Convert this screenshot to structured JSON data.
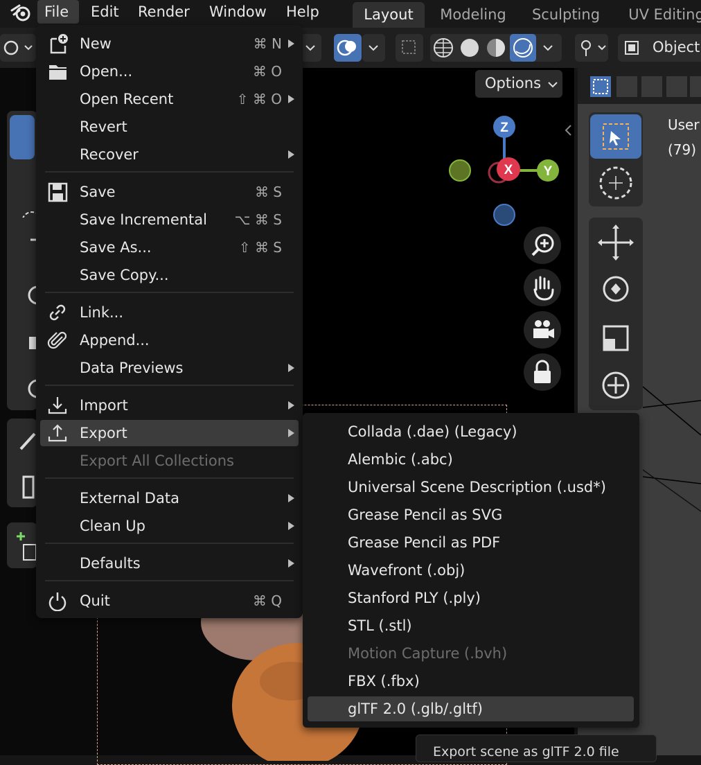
{
  "top_menu": {
    "file": "File",
    "edit": "Edit",
    "render": "Render",
    "window": "Window",
    "help": "Help"
  },
  "workspaces": [
    "Layout",
    "Modeling",
    "Sculpting",
    "UV Editing"
  ],
  "header": {
    "options_label": "Options",
    "object_mode_label": "Object"
  },
  "viewport_right": {
    "view_name": "User",
    "frame": "(79)"
  },
  "gizmo": {
    "x": "X",
    "y": "Y",
    "z": "Z"
  },
  "file_menu": {
    "items": [
      {
        "label": "New",
        "shortcut": "⌘ N",
        "icon": "new-file-icon",
        "submenu": true
      },
      {
        "label": "Open...",
        "shortcut": "⌘ O",
        "icon": "folder-icon"
      },
      {
        "label": "Open Recent",
        "shortcut": "⇧ ⌘ O",
        "submenu": true
      },
      {
        "label": "Revert"
      },
      {
        "label": "Recover",
        "submenu": true
      },
      {
        "label": "Save",
        "shortcut": "⌘ S",
        "icon": "save-icon"
      },
      {
        "label": "Save Incremental",
        "shortcut": "⌥ ⌘ S"
      },
      {
        "label": "Save As...",
        "shortcut": "⇧ ⌘ S"
      },
      {
        "label": "Save Copy..."
      },
      {
        "label": "Link...",
        "icon": "link-icon"
      },
      {
        "label": "Append...",
        "icon": "paperclip-icon"
      },
      {
        "label": "Data Previews",
        "submenu": true
      },
      {
        "label": "Import",
        "icon": "import-icon",
        "submenu": true
      },
      {
        "label": "Export",
        "icon": "export-icon",
        "submenu": true,
        "highlighted": true
      },
      {
        "label": "Export All Collections",
        "disabled": true
      },
      {
        "label": "External Data",
        "submenu": true
      },
      {
        "label": "Clean Up",
        "submenu": true
      },
      {
        "label": "Defaults",
        "submenu": true
      },
      {
        "label": "Quit",
        "shortcut": "⌘ Q",
        "icon": "power-icon"
      }
    ]
  },
  "export_menu": {
    "items": [
      {
        "label": "Collada (.dae) (Legacy)"
      },
      {
        "label": "Alembic (.abc)"
      },
      {
        "label": "Universal Scene Description (.usd*)"
      },
      {
        "label": "Grease Pencil as SVG"
      },
      {
        "label": "Grease Pencil as PDF"
      },
      {
        "label": "Wavefront (.obj)"
      },
      {
        "label": "Stanford PLY (.ply)"
      },
      {
        "label": "STL (.stl)"
      },
      {
        "label": "Motion Capture (.bvh)",
        "disabled": true
      },
      {
        "label": "FBX (.fbx)"
      },
      {
        "label": "glTF 2.0 (.glb/.gltf)",
        "highlighted": true
      }
    ]
  },
  "tooltip": "Export scene as glTF 2.0 file"
}
